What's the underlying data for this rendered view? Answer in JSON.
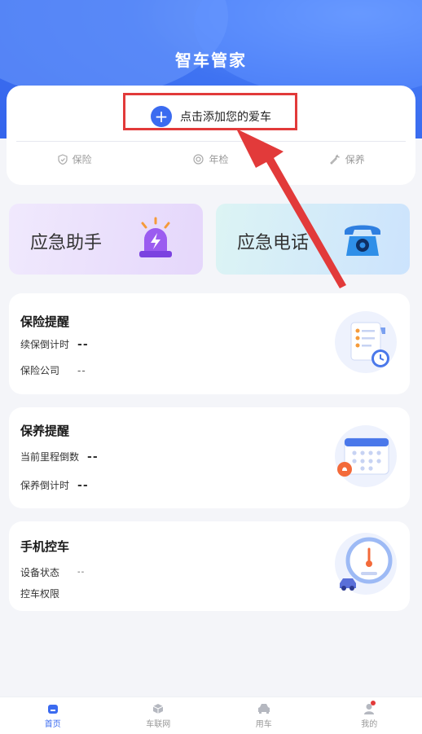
{
  "app": {
    "title": "智车管家"
  },
  "add_car": {
    "label": "点击添加您的爱车",
    "icon": "plus-icon"
  },
  "top_tabs": [
    {
      "label": "保险",
      "icon": "shield-icon"
    },
    {
      "label": "年检",
      "icon": "target-icon"
    },
    {
      "label": "保养",
      "icon": "wrench-icon"
    }
  ],
  "tiles": [
    {
      "label": "应急助手",
      "icon": "alarm-light-icon"
    },
    {
      "label": "应急电话",
      "icon": "telephone-icon"
    }
  ],
  "insurance": {
    "title": "保险提醒",
    "renew_label": "续保倒计时",
    "renew_value": "--",
    "company_label": "保险公司",
    "company_value": "--"
  },
  "maintenance": {
    "title": "保养提醒",
    "mileage_label": "当前里程倒数",
    "mileage_value": "--",
    "countdown_label": "保养倒计时",
    "countdown_value": "--"
  },
  "control": {
    "title": "手机控车",
    "device_label": "设备状态",
    "device_value": "--",
    "permission_label": "控车权限"
  },
  "nav": [
    {
      "label": "首页",
      "icon": "home-icon",
      "active": true
    },
    {
      "label": "车联网",
      "icon": "cube-icon",
      "active": false
    },
    {
      "label": "用车",
      "icon": "car-icon",
      "active": false
    },
    {
      "label": "我的",
      "icon": "user-icon",
      "active": false
    }
  ],
  "colors": {
    "primary": "#3b6bf0",
    "annotation": "#e23a3a"
  }
}
